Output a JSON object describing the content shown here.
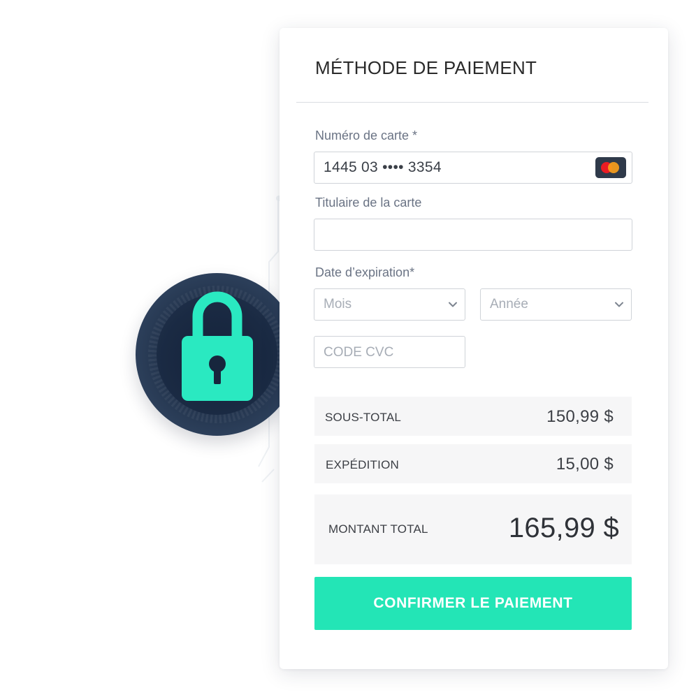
{
  "payment": {
    "title": "MÉTHODE DE PAIEMENT",
    "card_number_label": "Numéro de carte *",
    "card_number_value": "1445 03 •••• 3354",
    "card_brand_icon": "mastercard-icon",
    "holder_label": "Titulaire de la carte",
    "holder_value": "",
    "expiry_label": "Date d’expiration*",
    "month_placeholder": "Mois",
    "year_placeholder": "Année",
    "cvc_placeholder": "CODE CVC"
  },
  "summary": {
    "subtotal_label": "SOUS-TOTAL",
    "subtotal_value": "150,99 $",
    "shipping_label": "EXPÉDITION",
    "shipping_value": "15,00 $",
    "total_label": "MONTANT TOTAL",
    "total_value": "165,99 $"
  },
  "actions": {
    "confirm_label": "CONFIRMER LE PAIEMENT"
  },
  "badge": {
    "icon": "padlock-icon"
  },
  "colors": {
    "accent": "#23e5b6",
    "lock_green": "#2ae9c1",
    "badge_navy": "#23344d"
  }
}
